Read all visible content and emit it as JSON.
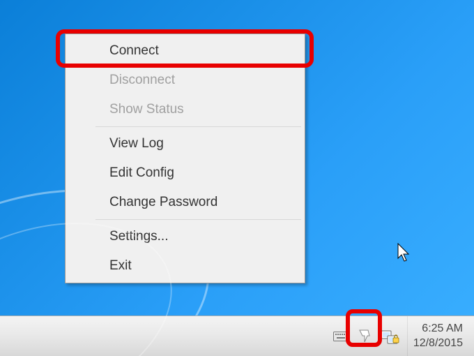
{
  "menu": {
    "items": [
      {
        "label": "Connect",
        "enabled": true
      },
      {
        "label": "Disconnect",
        "enabled": false
      },
      {
        "label": "Show Status",
        "enabled": false
      },
      {
        "separator": true
      },
      {
        "label": "View Log",
        "enabled": true
      },
      {
        "label": "Edit Config",
        "enabled": true
      },
      {
        "label": "Change Password",
        "enabled": true
      },
      {
        "separator": true
      },
      {
        "label": "Settings...",
        "enabled": true
      },
      {
        "label": "Exit",
        "enabled": true
      }
    ]
  },
  "taskbar": {
    "time": "6:25 AM",
    "date": "12/8/2015"
  },
  "highlight_color": "#e80000"
}
